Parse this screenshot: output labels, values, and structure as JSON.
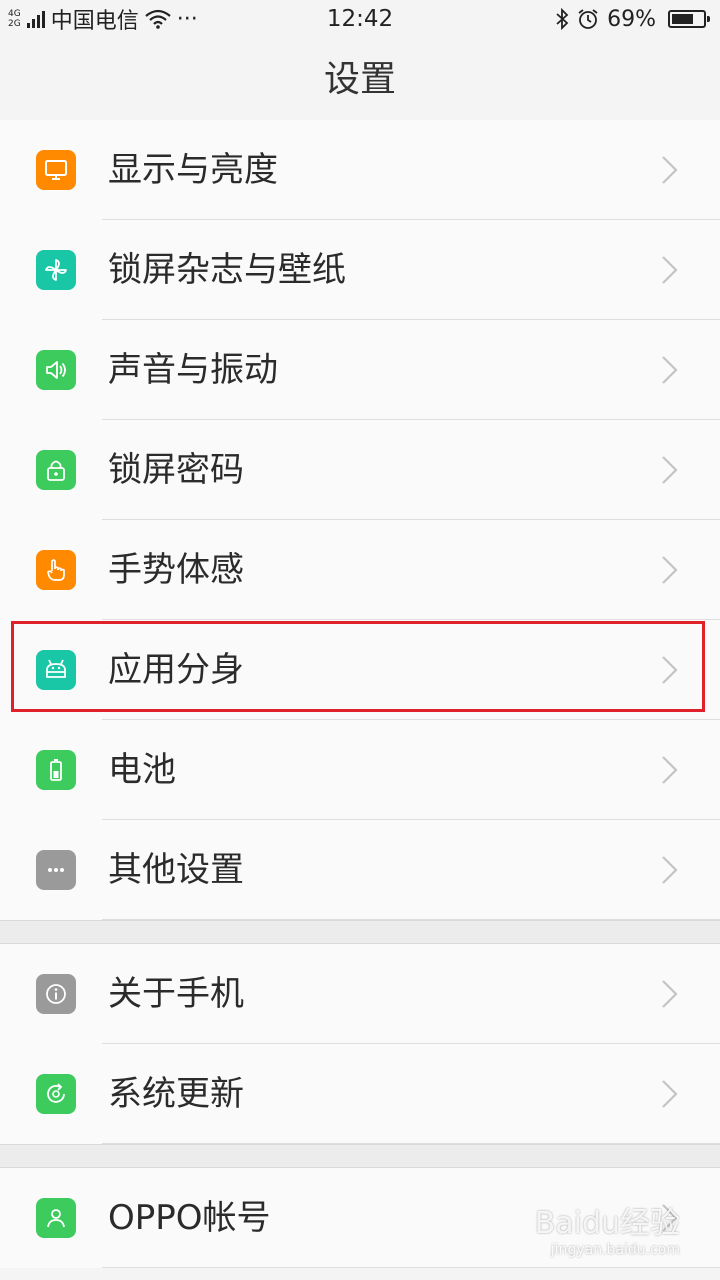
{
  "status_bar": {
    "net_top": "4G",
    "net_bottom": "2G",
    "carrier": "中国电信",
    "more": "···",
    "time": "12:42",
    "battery": "69%",
    "battery_level": 0.69
  },
  "header": {
    "title": "设置"
  },
  "groups": [
    {
      "items": [
        {
          "label": "显示与亮度",
          "icon": "display-icon",
          "color": "#ff8a00"
        },
        {
          "label": "锁屏杂志与壁纸",
          "icon": "pinwheel-icon",
          "color": "#19c6a6"
        },
        {
          "label": "声音与振动",
          "icon": "speaker-icon",
          "color": "#3ecb5e"
        },
        {
          "label": "锁屏密码",
          "icon": "lock-icon",
          "color": "#3ecb5e"
        },
        {
          "label": "手势体感",
          "icon": "gesture-hand-icon",
          "color": "#ff8a00"
        },
        {
          "label": "应用分身",
          "icon": "app-clone-icon",
          "color": "#19c6a6"
        },
        {
          "label": "电池",
          "icon": "battery-icon",
          "color": "#3ecb5e"
        },
        {
          "label": "其他设置",
          "icon": "more-dots-icon",
          "color": "#9a9a9a"
        }
      ]
    },
    {
      "items": [
        {
          "label": "关于手机",
          "icon": "info-icon",
          "color": "#9a9a9a"
        },
        {
          "label": "系统更新",
          "icon": "update-icon",
          "color": "#3ecb5e"
        }
      ]
    },
    {
      "items": [
        {
          "label": "OPPO帐号",
          "icon": "account-icon",
          "color": "#3ecb5e"
        }
      ]
    }
  ],
  "watermark": {
    "text": "Baidu经验",
    "sub": "jingyan.baidu.com"
  }
}
